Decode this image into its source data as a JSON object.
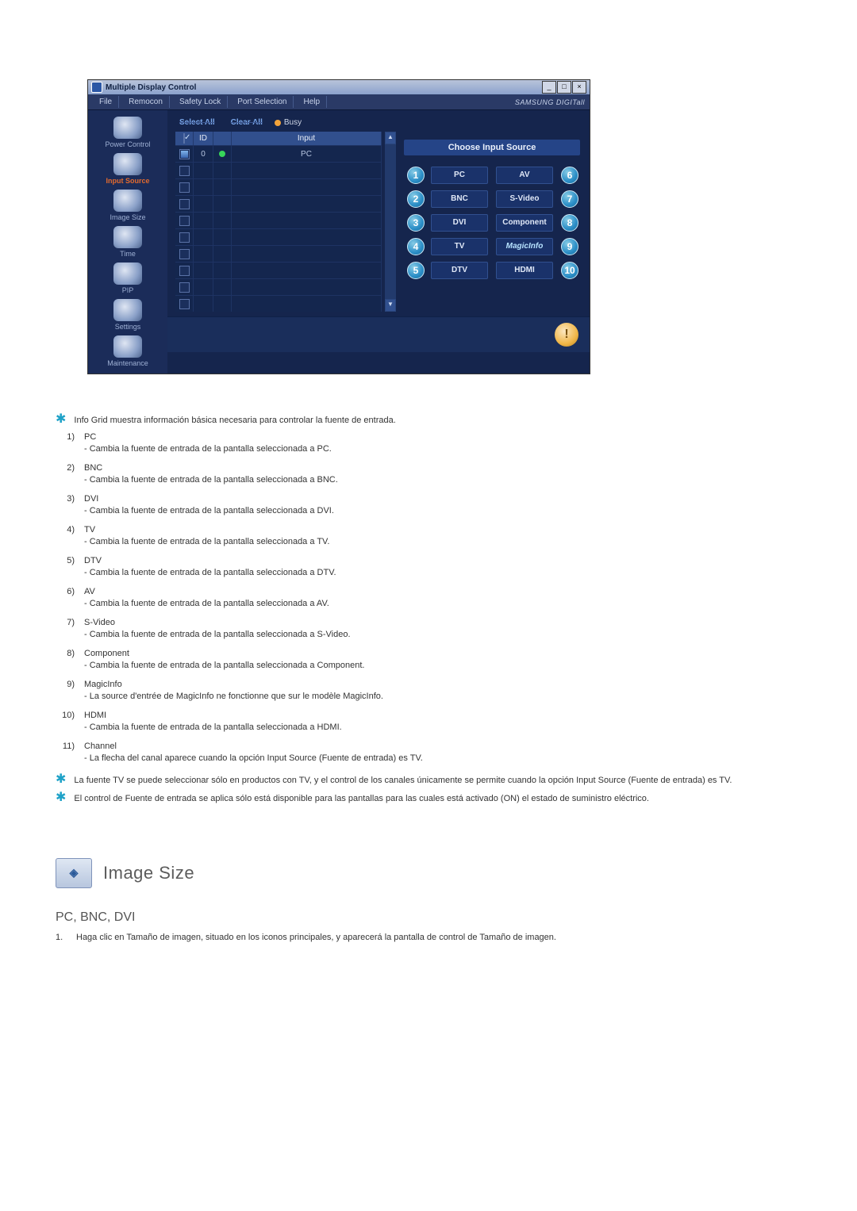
{
  "window": {
    "title": "Multiple Display Control",
    "controls": {
      "min": "_",
      "max": "□",
      "close": "×"
    }
  },
  "menubar": {
    "items": [
      "File",
      "Remocon",
      "Safety Lock",
      "Port Selection",
      "Help"
    ],
    "brand": "SAMSUNG DIGITall"
  },
  "sidebar": {
    "items": [
      {
        "label": "Power Control"
      },
      {
        "label": "Input Source"
      },
      {
        "label": "Image Size"
      },
      {
        "label": "Time"
      },
      {
        "label": "PIP"
      },
      {
        "label": "Settings"
      },
      {
        "label": "Maintenance"
      }
    ],
    "active_index": 1
  },
  "toolbar": {
    "select_all": "Select All",
    "clear_all": "Clear All",
    "busy": "Busy"
  },
  "grid": {
    "headers": {
      "c1": "✓",
      "c2": "ID",
      "c3": "",
      "c4": "Input"
    },
    "first_row": {
      "id": "0",
      "input": "PC"
    }
  },
  "panel": {
    "title": "Choose Input Source",
    "left_col": [
      {
        "n": "1",
        "label": "PC"
      },
      {
        "n": "2",
        "label": "BNC"
      },
      {
        "n": "3",
        "label": "DVI"
      },
      {
        "n": "4",
        "label": "TV"
      },
      {
        "n": "5",
        "label": "DTV"
      }
    ],
    "right_col": [
      {
        "n": "6",
        "label": "AV"
      },
      {
        "n": "7",
        "label": "S-Video"
      },
      {
        "n": "8",
        "label": "Component"
      },
      {
        "n": "9",
        "label": "MagicInfo"
      },
      {
        "n": "10",
        "label": "HDMI"
      }
    ]
  },
  "notes": {
    "intro": "Info Grid muestra información básica necesaria para controlar la fuente de entrada.",
    "list": [
      {
        "n": "1)",
        "t": "PC",
        "d": "- Cambia la fuente de entrada de la pantalla seleccionada a PC."
      },
      {
        "n": "2)",
        "t": "BNC",
        "d": "- Cambia la fuente de entrada de la pantalla seleccionada a BNC."
      },
      {
        "n": "3)",
        "t": "DVI",
        "d": "- Cambia la fuente de entrada de la pantalla seleccionada a DVI."
      },
      {
        "n": "4)",
        "t": "TV",
        "d": "- Cambia la fuente de entrada de la pantalla seleccionada a TV."
      },
      {
        "n": "5)",
        "t": "DTV",
        "d": "- Cambia la fuente de entrada de la pantalla seleccionada a DTV."
      },
      {
        "n": "6)",
        "t": "AV",
        "d": "- Cambia la fuente de entrada de la pantalla seleccionada a AV."
      },
      {
        "n": "7)",
        "t": "S-Video",
        "d": "- Cambia la fuente de entrada de la pantalla seleccionada a S-Video."
      },
      {
        "n": "8)",
        "t": "Component",
        "d": "- Cambia la fuente de entrada de la pantalla seleccionada a Component."
      },
      {
        "n": "9)",
        "t": "MagicInfo",
        "d": "- La source d'entrée de MagicInfo ne fonctionne que sur le modèle MagicInfo."
      },
      {
        "n": "10)",
        "t": "HDMI",
        "d": "- Cambia la fuente de entrada de la pantalla seleccionada a HDMI."
      },
      {
        "n": "11)",
        "t": "Channel",
        "d": "- La flecha del canal aparece cuando la opción Input Source (Fuente de entrada) es TV."
      }
    ],
    "bold1": "La fuente TV se puede seleccionar sólo en productos con TV, y el control de los canales únicamente se permite cuando la opción Input Source (Fuente de entrada) es TV.",
    "bold2": "El control de Fuente de entrada se aplica sólo está disponible para las pantallas para las cuales está activado (ON) el estado de suministro eléctrico."
  },
  "image_size": {
    "title": "Image Size",
    "subtitle": "PC, BNC, DVI",
    "p1_num": "1.",
    "p1": "Haga clic en Tamaño de imagen, situado en los iconos principales, y aparecerá la pantalla de control de Tamaño de imagen."
  }
}
